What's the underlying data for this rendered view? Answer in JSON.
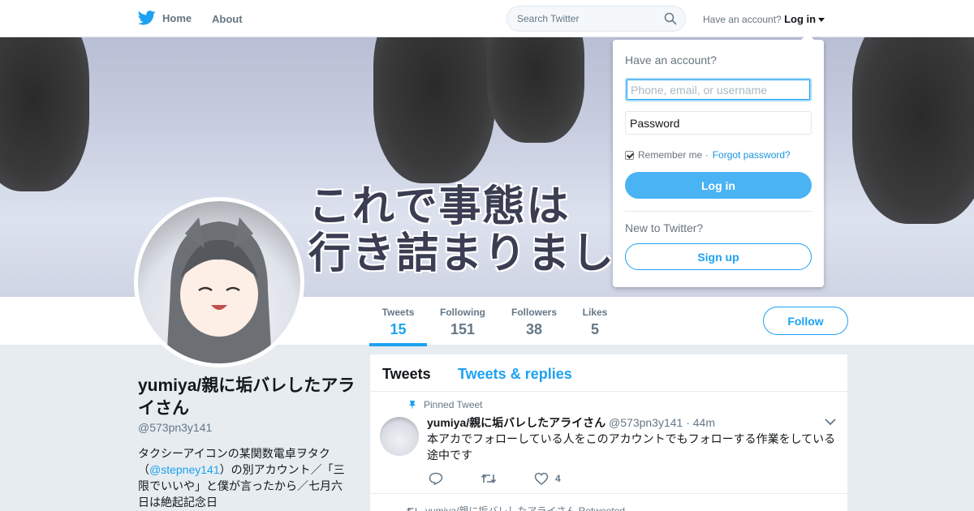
{
  "nav": {
    "home_label": "Home",
    "about_label": "About",
    "search_placeholder": "Search Twitter",
    "account_prompt": "Have an account?",
    "login_label": "Log in"
  },
  "banner": {
    "caption_line1": "これで事態は",
    "caption_line2": "行き詰まりまし"
  },
  "stats": [
    {
      "label": "Tweets",
      "value": "15"
    },
    {
      "label": "Following",
      "value": "151"
    },
    {
      "label": "Followers",
      "value": "38"
    },
    {
      "label": "Likes",
      "value": "5"
    }
  ],
  "follow_label": "Follow",
  "profile": {
    "name": "yumiya/親に垢バレしたアライさん",
    "handle": "@573pn3y141",
    "bio_before": "タクシーアイコンの某関数電卓ヲタク（",
    "bio_link": "@stepney141",
    "bio_after": "）の別アカウント／「三限でいいや」と僕が言ったから／七月六日は絶起記念日"
  },
  "timeline": {
    "tab_tweets": "Tweets",
    "tab_replies": "Tweets & replies",
    "tweet": {
      "pinned_label": "Pinned Tweet",
      "author_name": "yumiya/親に垢バレしたアライさん",
      "author_handle": "@573pn3y141",
      "time": "· 44m",
      "text": "本アカでフォローしている人をこのアカウントでもフォローする作業をしている途中です",
      "likes": "4"
    },
    "next_retweet_label": "yumiya/親に垢バレしたアライさん Retweeted"
  },
  "login_dropdown": {
    "title": "Have an account?",
    "username_placeholder": "Phone, email, or username",
    "password_placeholder": "Password",
    "remember_label": "Remember me ·",
    "forgot_label": "Forgot password?",
    "login_button": "Log in",
    "new_prompt": "New to Twitter?",
    "signup_button": "Sign up"
  },
  "colors": {
    "brand": "#1da1f2",
    "background": "#e6ecf0"
  }
}
